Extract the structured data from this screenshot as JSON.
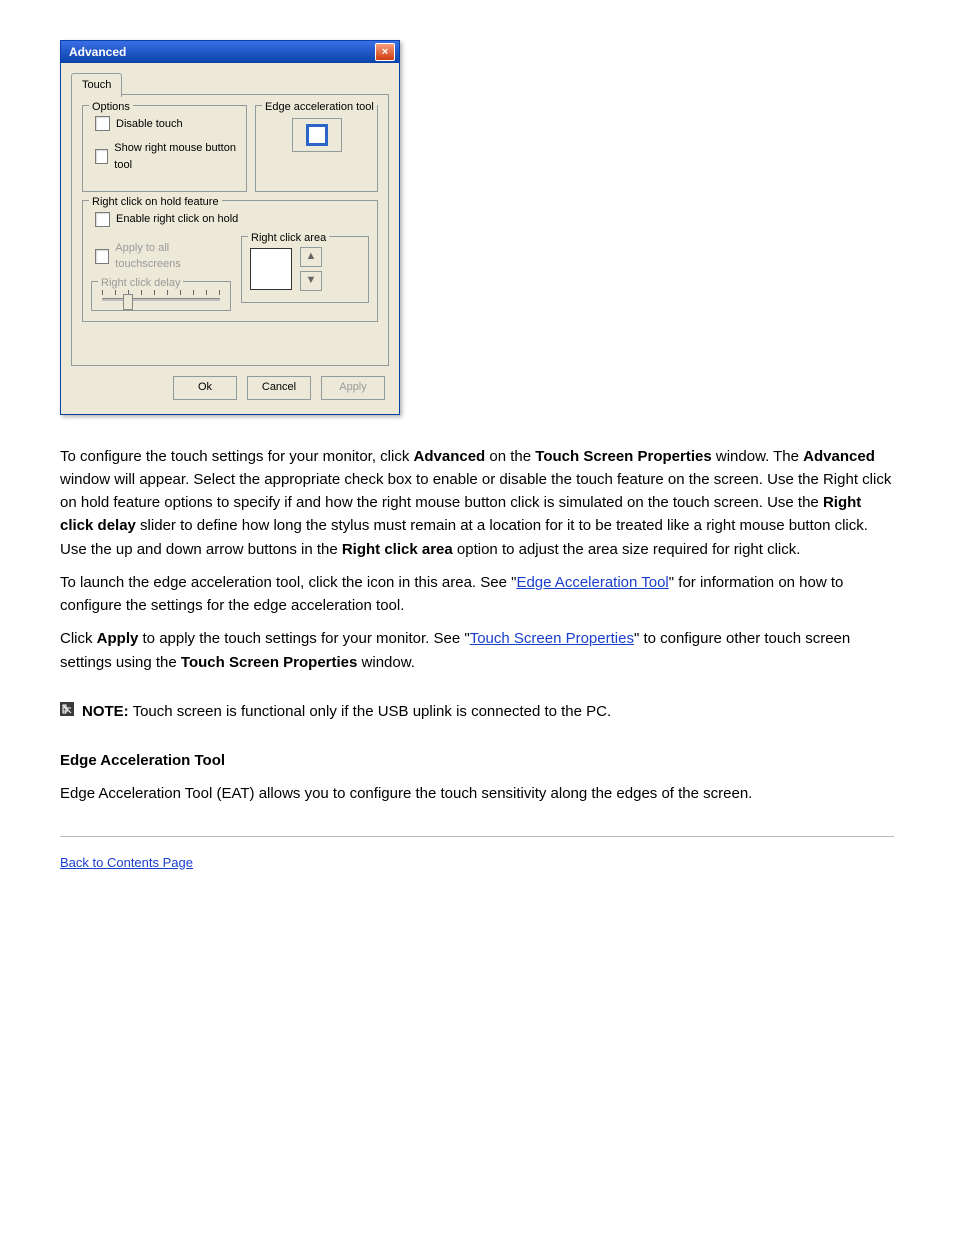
{
  "dialog": {
    "title": "Advanced",
    "tab": "Touch",
    "options": {
      "legend": "Options",
      "disable_touch": "Disable touch",
      "show_rmb_tool": "Show right mouse button tool"
    },
    "edge": {
      "legend": "Edge acceleration tool"
    },
    "rc_feature": {
      "legend": "Right click on hold feature",
      "enable": "Enable right click on hold",
      "apply_all": "Apply to all touchscreens",
      "delay_legend": "Right click delay"
    },
    "rc_area": {
      "legend": "Right click area"
    },
    "buttons": {
      "ok": "Ok",
      "cancel": "Cancel",
      "apply": "Apply"
    }
  },
  "paragraphs": {
    "p1a": "To configure the touch settings for your monitor, click ",
    "p1b": "Advanced",
    "p1c": " on the ",
    "p1d": "Touch Screen Properties",
    "p1e": " window. The ",
    "p1f": "Advanced",
    "p1g": " window will appear. Select the appropriate check box to enable or disable the touch feature on the screen. Use the Right click on hold feature options to specify if and how the right mouse button click is simulated on the touch screen. Use the ",
    "p1h": "Right click delay",
    "p1i": " slider to define how long the stylus must remain at a location for it to be treated like a right mouse button click. Use the up and down arrow buttons in the ",
    "p1j": "Right click area",
    "p1k": " option to adjust the area size required for right click.",
    "p2a": "To launch the edge acceleration tool, click the icon in this area. See \"",
    "p2b": "Edge Acceleration Tool",
    "p2c": "\" for information on how to configure the settings for the edge acceleration tool.",
    "p3a": "Click ",
    "p3b": "Apply",
    "p3c": " to apply the touch settings for your monitor. See \"",
    "p3d": "Touch Screen Properties",
    "p3e": "\" to configure other touch screen settings using the ",
    "p3f": "Touch Screen Properties",
    "p3g": " window.",
    "note_label": "NOTE:",
    "note_text": " Touch screen is functional only if the USB uplink is connected to the PC.",
    "h2": "Edge Acceleration Tool",
    "h2_sub": "Edge Acceleration Tool (EAT) allows you to configure the touch sensitivity along the edges of the screen.",
    "back_top": "Back to Contents Page"
  },
  "links": {
    "edge_tool": "Edge Acceleration Tool",
    "touch_props": "Touch Screen Properties",
    "back_top": "Back to Contents Page"
  }
}
